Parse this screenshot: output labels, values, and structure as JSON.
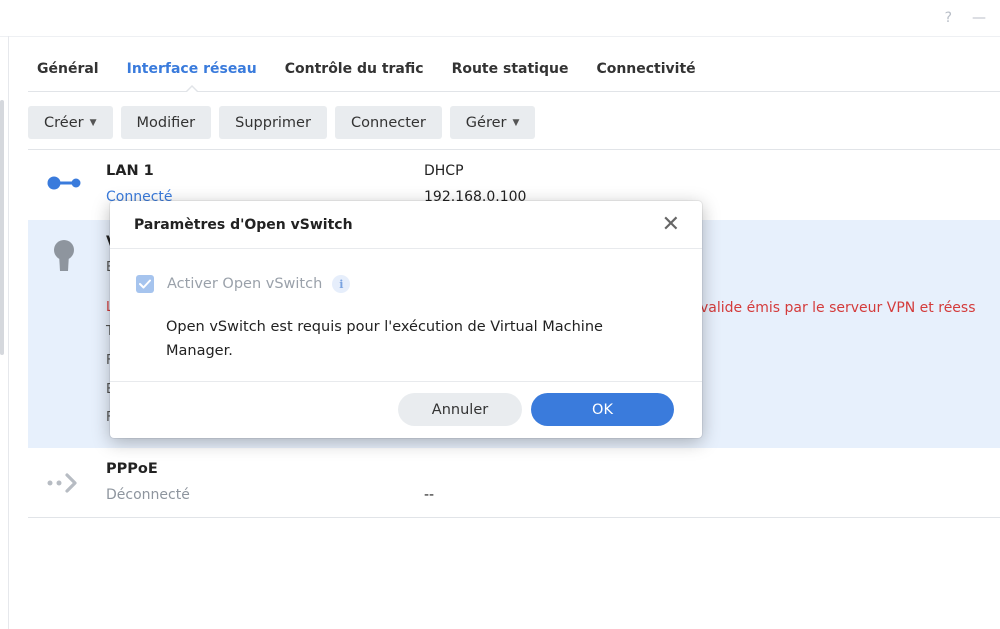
{
  "window": {
    "help_label": "?",
    "minimize_label": "—"
  },
  "tabs": [
    {
      "label": "Général",
      "active": false
    },
    {
      "label": "Interface réseau",
      "active": true
    },
    {
      "label": "Contrôle du trafic",
      "active": false
    },
    {
      "label": "Route statique",
      "active": false
    },
    {
      "label": "Connectivité",
      "active": false
    }
  ],
  "toolbar": {
    "create_label": "Créer",
    "modify_label": "Modifier",
    "delete_label": "Supprimer",
    "connect_label": "Connecter",
    "manage_label": "Gérer"
  },
  "interfaces": {
    "lan": {
      "name": "LAN 1",
      "status": "Connecté",
      "mode": "DHCP",
      "ip": "192.168.0.100",
      "icon": "ethernet-connected-icon"
    },
    "vpn": {
      "name_fragment": "V",
      "status_fragment": "E",
      "error_fragment": "L",
      "line1_fragment": "T",
      "line2_fragment": "F",
      "line3_fragment": "E",
      "line4_fragment": "F",
      "error_text": "valide émis par le serveur VPN et réess",
      "icon": "lock-icon"
    },
    "pppoe": {
      "name": "PPPoE",
      "status": "Déconnecté",
      "ip": "--",
      "icon": "pppoe-disconnected-icon"
    }
  },
  "dialog": {
    "title": "Paramètres d'Open vSwitch",
    "checkbox_label": "Activer Open vSwitch",
    "checkbox_checked": true,
    "info_icon_glyph": "i",
    "description": "Open vSwitch est requis pour l'exécution de Virtual Machine Manager.",
    "cancel_label": "Annuler",
    "ok_label": "OK"
  },
  "colors": {
    "accent": "#3a7bdc",
    "error": "#d43b3b",
    "selected_row": "#e7f0fc"
  }
}
